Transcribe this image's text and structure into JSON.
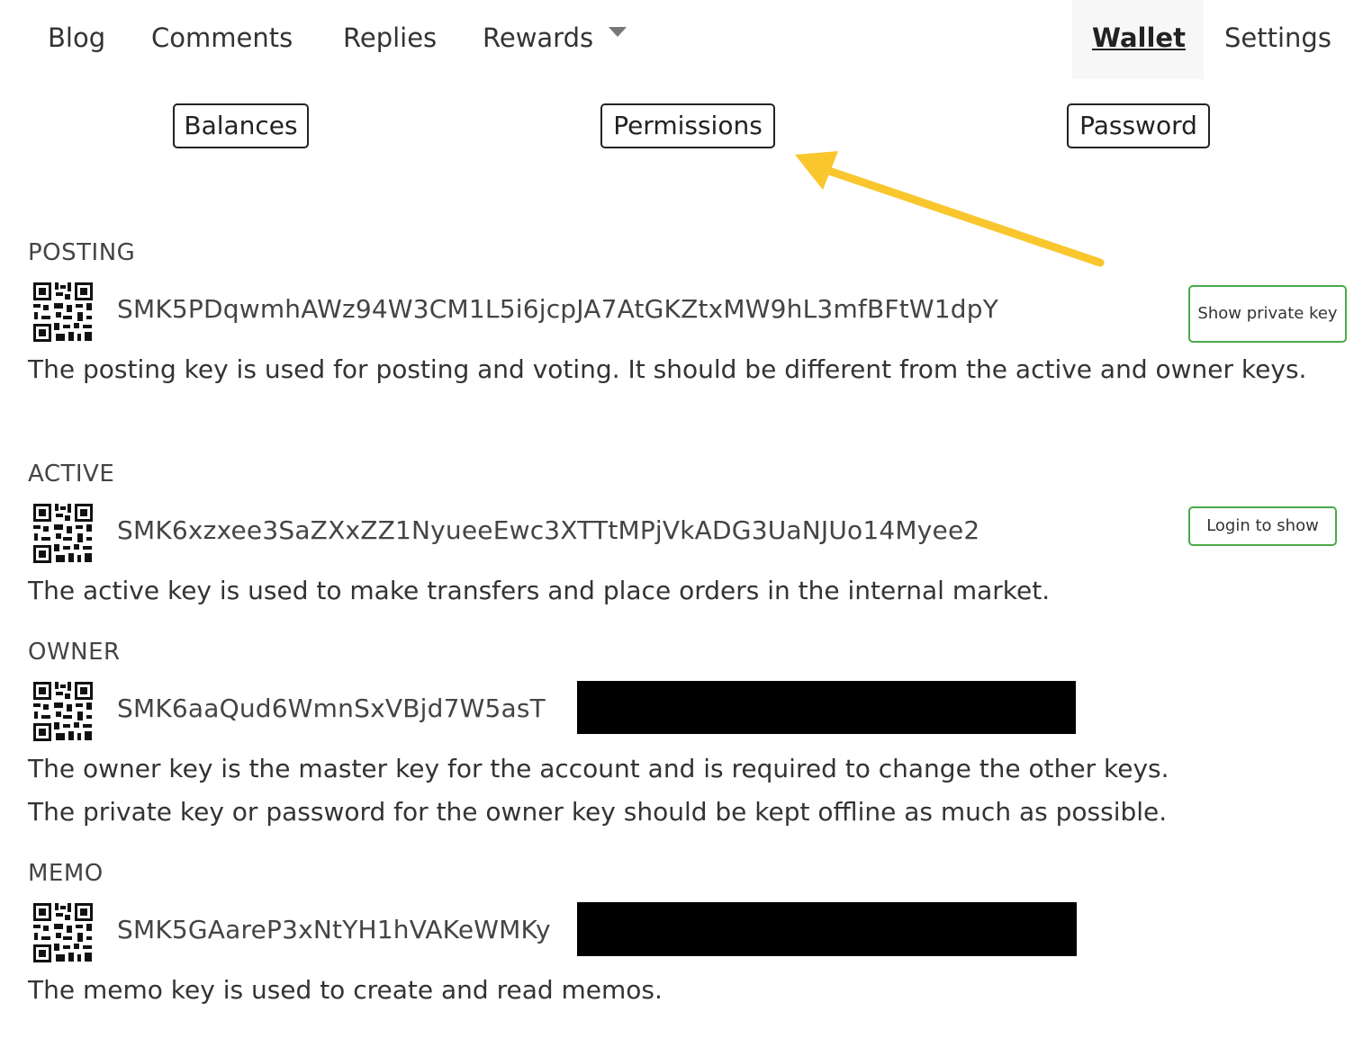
{
  "topnav": {
    "blog": "Blog",
    "comments": "Comments",
    "replies": "Replies",
    "rewards": "Rewards",
    "wallet": "Wallet",
    "settings": "Settings"
  },
  "subnav": {
    "balances": "Balances",
    "permissions": "Permissions",
    "password": "Password"
  },
  "annotation": {
    "arrow_color": "#f9c62d"
  },
  "accent_color": "#4ba94b",
  "sections": {
    "posting": {
      "label": "POSTING",
      "key": "SMK5PDqwmhAWz94W3CM1L5i6jcpJA7AtGKZtxMW9hL3mfBFtW1dpY",
      "button": "Show private key",
      "description": "The posting key is used for posting and voting. It should be different from the active and owner keys."
    },
    "active": {
      "label": "ACTIVE",
      "key": "SMK6xzxee3SaZXxZZ1NyueeEwc3XTTtMPjVkADG3UaNJUo14Myee2",
      "button": "Login to show",
      "description": "The active key is used to make transfers and place orders in the internal market."
    },
    "owner": {
      "label": "OWNER",
      "key": "SMK6aaQud6WmnSxVBjd7W5asT",
      "description_1": "The owner key is the master key for the account and is required to change the other keys.",
      "description_2": "The private key or password for the owner key should be kept offline as much as possible."
    },
    "memo": {
      "label": "MEMO",
      "key": "SMK5GAareP3xNtYH1hVAKeWMKy",
      "description": "The memo key is used to create and read memos."
    }
  }
}
